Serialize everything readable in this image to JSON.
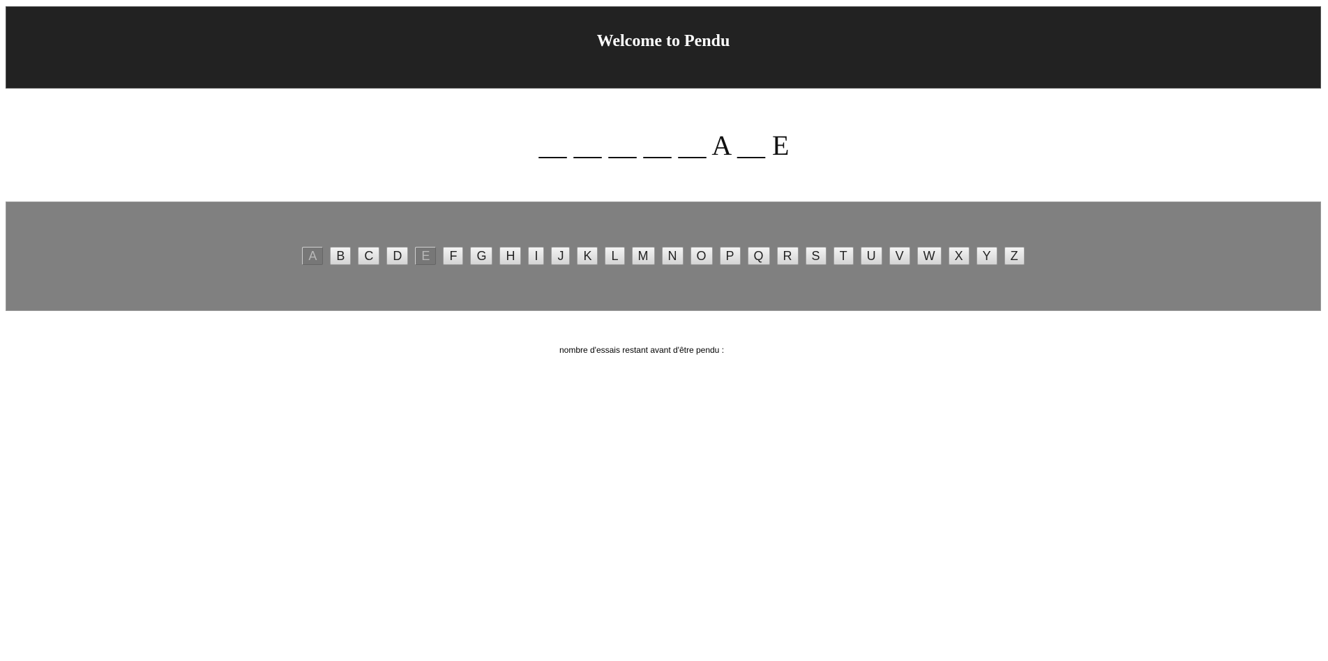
{
  "header": {
    "title": "Welcome to Pendu"
  },
  "word": {
    "display": "__ __ __ __ __ A __ E"
  },
  "keyboard": {
    "keys": [
      {
        "label": "A",
        "used": true
      },
      {
        "label": "B",
        "used": false
      },
      {
        "label": "C",
        "used": false
      },
      {
        "label": "D",
        "used": false
      },
      {
        "label": "E",
        "used": true
      },
      {
        "label": "F",
        "used": false
      },
      {
        "label": "G",
        "used": false
      },
      {
        "label": "H",
        "used": false
      },
      {
        "label": "I",
        "used": false
      },
      {
        "label": "J",
        "used": false
      },
      {
        "label": "K",
        "used": false
      },
      {
        "label": "L",
        "used": false
      },
      {
        "label": "M",
        "used": false
      },
      {
        "label": "N",
        "used": false
      },
      {
        "label": "O",
        "used": false
      },
      {
        "label": "P",
        "used": false
      },
      {
        "label": "Q",
        "used": false
      },
      {
        "label": "R",
        "used": false
      },
      {
        "label": "S",
        "used": false
      },
      {
        "label": "T",
        "used": false
      },
      {
        "label": "U",
        "used": false
      },
      {
        "label": "V",
        "used": false
      },
      {
        "label": "W",
        "used": false
      },
      {
        "label": "X",
        "used": false
      },
      {
        "label": "Y",
        "used": false
      },
      {
        "label": "Z",
        "used": false
      }
    ]
  },
  "status": {
    "label": "nombre d'essais restant avant d'être pendu :"
  },
  "colors": {
    "header_bg": "#222222",
    "keyboard_bg": "#808080",
    "used_key_bg": "#777777"
  }
}
